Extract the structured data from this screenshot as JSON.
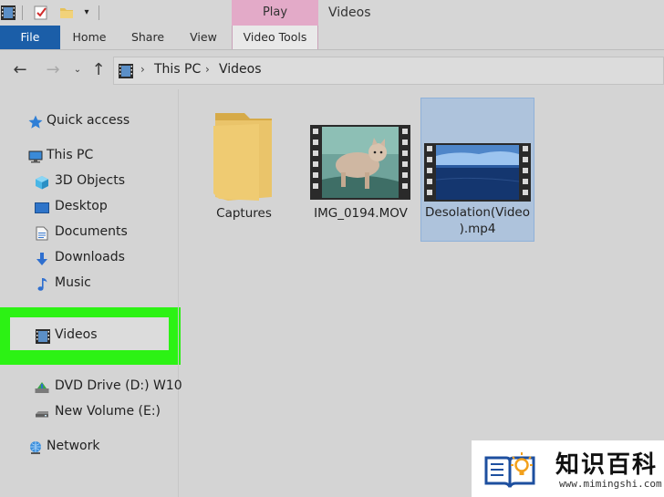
{
  "window": {
    "title": "Videos",
    "context_tab": "Play",
    "context_group": "Video Tools"
  },
  "quick_access_toolbar": {
    "dropdown_glyph": "▾",
    "icons": [
      "video-film-icon",
      "properties-icon",
      "new-folder-icon"
    ]
  },
  "ribbon": {
    "tabs": [
      {
        "label": "File"
      },
      {
        "label": "Home"
      },
      {
        "label": "Share"
      },
      {
        "label": "View"
      }
    ],
    "file_tab_color": "#1b5ea8",
    "context_color": "#e3aac8"
  },
  "navigation": {
    "back_glyph": "←",
    "forward_glyph": "→",
    "recent_glyph": "⌄",
    "up_glyph": "↑",
    "separator_glyph": "›",
    "breadcrumb": [
      "This PC",
      "Videos"
    ]
  },
  "sidebar": {
    "items": [
      {
        "label": "Quick access",
        "icon": "star-icon"
      },
      {
        "label": "This PC",
        "icon": "computer-icon"
      },
      {
        "label": "3D Objects",
        "icon": "cube-icon"
      },
      {
        "label": "Desktop",
        "icon": "desktop-icon"
      },
      {
        "label": "Documents",
        "icon": "document-icon"
      },
      {
        "label": "Downloads",
        "icon": "download-arrow-icon"
      },
      {
        "label": "Music",
        "icon": "music-note-icon"
      },
      {
        "label": "Videos",
        "icon": "video-film-icon"
      },
      {
        "label": "DVD Drive (D:) W10",
        "icon": "dvd-drive-icon"
      },
      {
        "label": "New Volume (E:)",
        "icon": "drive-icon"
      },
      {
        "label": "Network",
        "icon": "network-icon"
      }
    ],
    "highlight_color": "#2cf214"
  },
  "content": {
    "items": [
      {
        "label": "Captures",
        "type": "folder",
        "icon": "folder-icon"
      },
      {
        "label": "IMG_0194.MOV",
        "type": "video",
        "icon": "video-thumbnail-cat"
      },
      {
        "label_line1": "Desolation(Video",
        "label_line2": ").mp4",
        "type": "video",
        "icon": "video-thumbnail-sea",
        "selected": true
      }
    ],
    "selection_color": "#aec3dc"
  },
  "watermark": {
    "title": "知识百科",
    "url": "www.mimingshi.com"
  }
}
